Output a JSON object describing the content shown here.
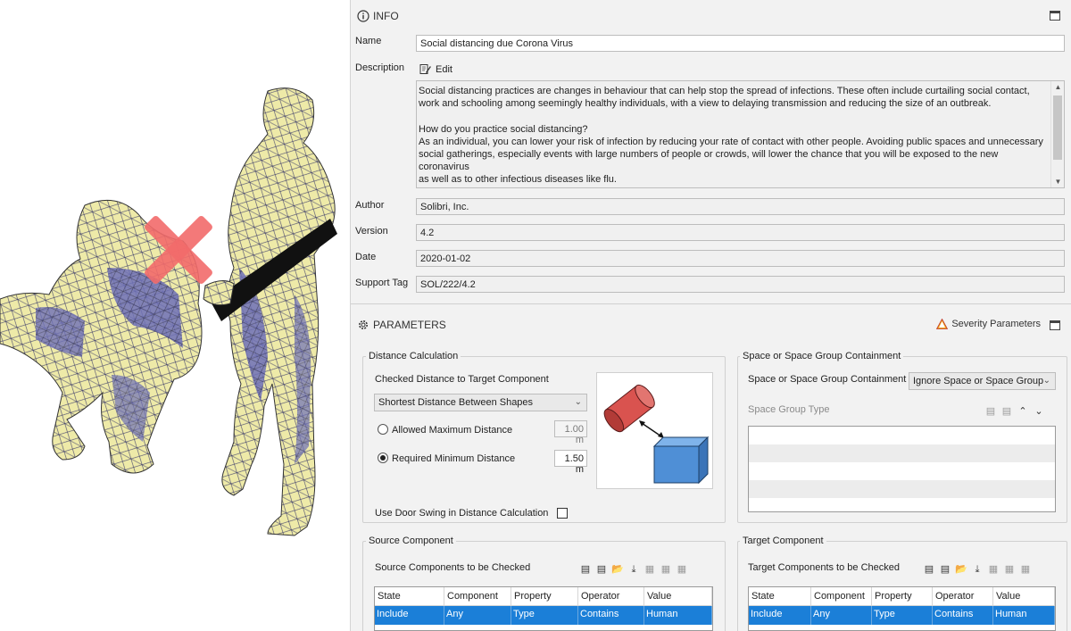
{
  "info": {
    "title": "INFO",
    "name_label": "Name",
    "name_value": "Social distancing due Corona Virus",
    "description_label": "Description",
    "edit_label": "Edit",
    "description_text": "Social distancing practices are changes in behaviour that can help stop the spread of infections. These often include curtailing social contact,\nwork and schooling among seemingly healthy individuals, with a view to delaying transmission and reducing the size of an outbreak.\n\nHow do you practice social distancing?\nAs an individual, you can lower your risk of infection by reducing your rate of contact with other people. Avoiding public spaces and unnecessary\nsocial gatherings, especially events with large numbers of people or crowds, will lower the chance that you will be exposed to the new coronavirus\nas well as to other infectious diseases like flu.\nOther measures include working from home if possible, organising meetings via video calls rather than doing them in person and avoiding",
    "author_label": "Author",
    "author_value": "Solibri, Inc.",
    "version_label": "Version",
    "version_value": "4.2",
    "date_label": "Date",
    "date_value": "2020-01-02",
    "support_tag_label": "Support Tag",
    "support_tag_value": "SOL/222/4.2"
  },
  "parameters": {
    "title": "PARAMETERS",
    "severity_label": "Severity Parameters",
    "distance": {
      "group_title": "Distance Calculation",
      "checked_label": "Checked Distance to Target Component",
      "checked_value": "Shortest Distance Between Shapes",
      "allowed_label": "Allowed Maximum Distance",
      "allowed_value": "1.00 m",
      "required_label": "Required Minimum Distance",
      "required_value": "1.50 m",
      "selected": "required",
      "door_swing_label": "Use Door Swing in Distance Calculation",
      "door_swing_checked": false
    },
    "space": {
      "group_title": "Space or Space Group Containment",
      "containment_label": "Space or Space Group Containment",
      "containment_value": "Ignore Space or Space Group",
      "space_group_type_label": "Space Group Type"
    },
    "source": {
      "group_title": "Source Component",
      "list_label": "Source Components to be Checked",
      "columns": [
        "State",
        "Component",
        "Property",
        "Operator",
        "Value"
      ],
      "rows": [
        [
          "Include",
          "Any",
          "Type",
          "Contains",
          "Human"
        ]
      ]
    },
    "target": {
      "group_title": "Target Component",
      "list_label": "Target Components to be Checked",
      "columns": [
        "State",
        "Component",
        "Property",
        "Operator",
        "Value"
      ],
      "rows": [
        [
          "Include",
          "Any",
          "Type",
          "Contains",
          "Human"
        ]
      ]
    }
  },
  "colors": {
    "selection": "#1b7fd8",
    "warning_orange": "#f0a21a",
    "cross_red": "#f26a6a",
    "cylinder_red": "#d9534f",
    "box_blue": "#4f8fd6",
    "mesh_fill": "#eeeaa8",
    "mesh_shade": "#5b5fa8"
  },
  "icons": {
    "info": "info-circle-icon",
    "edit": "edit-document-icon",
    "params": "gear-icon",
    "severity": "warning-triangle-icon",
    "maximize": "maximize-icon"
  }
}
